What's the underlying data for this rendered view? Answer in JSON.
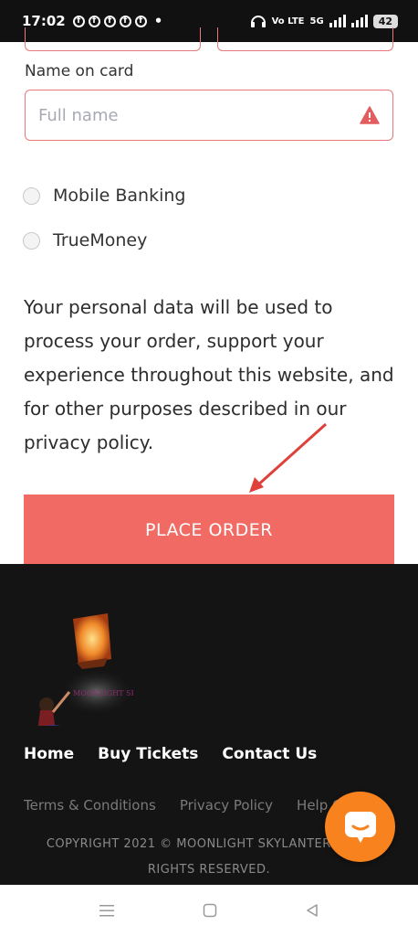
{
  "status_bar": {
    "time": "17:02",
    "notification_icons": [
      "facebook-icon",
      "facebook-icon",
      "facebook-icon",
      "facebook-icon",
      "facebook-icon"
    ],
    "dot": "•",
    "network": "Vo LTE",
    "network_type": "5G",
    "battery": "42"
  },
  "form": {
    "name_label": "Name on card",
    "name_placeholder": "Full name",
    "name_state": "error",
    "payment_options": [
      {
        "label": "Mobile Banking",
        "selected": false
      },
      {
        "label": "TrueMoney",
        "selected": false
      }
    ],
    "privacy_text": "Your personal data will be used to process your order, support your experience throughout this website, and for other purposes described in our privacy policy.",
    "place_order_label": "PLACE ORDER"
  },
  "footer": {
    "logo_text": "MOONLIGHT SKYLANTERN",
    "nav": [
      "Home",
      "Buy Tickets",
      "Contact Us"
    ],
    "links": [
      "Terms & Conditions",
      "Privacy Policy",
      "Help Center"
    ],
    "copyright_line1": "COPYRIGHT 2021 © MOONLIGHT SKYLANTERN. ALL",
    "copyright_line2": "RIGHTS RESERVED."
  },
  "colors": {
    "accent": "#f26a64",
    "error_border": "#e8797b",
    "footer_bg": "#141414",
    "chat_button": "#f7821e"
  }
}
